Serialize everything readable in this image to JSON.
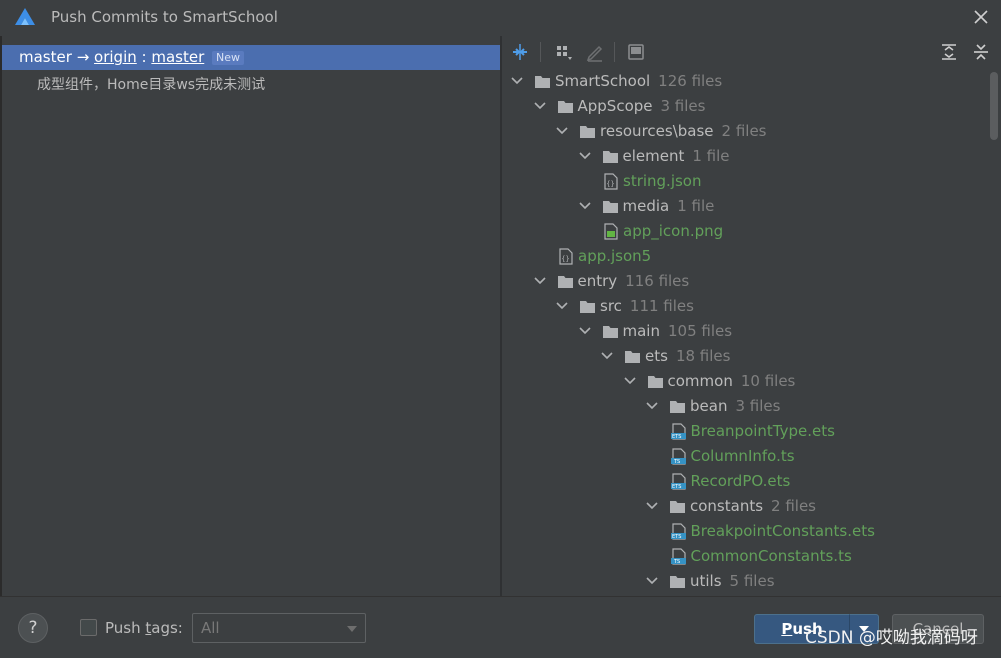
{
  "window": {
    "title": "Push Commits to SmartSchool"
  },
  "branch": {
    "local": "master",
    "arrow": "→",
    "remote": "origin",
    "sep": " : ",
    "target": "master",
    "badge": "New"
  },
  "commit": {
    "message": "成型组件，Home目录ws完成未测试"
  },
  "tree": [
    {
      "name": "SmartSchool",
      "count": "126 files",
      "type": "folder",
      "depth": 0,
      "expanded": true
    },
    {
      "name": "AppScope",
      "count": "3 files",
      "type": "folder",
      "depth": 1,
      "expanded": true
    },
    {
      "name": "resources\\base",
      "count": "2 files",
      "type": "folder",
      "depth": 2,
      "expanded": true
    },
    {
      "name": "element",
      "count": "1 file",
      "type": "folder",
      "depth": 3,
      "expanded": true
    },
    {
      "name": "string.json",
      "count": "",
      "type": "json",
      "depth": 4
    },
    {
      "name": "media",
      "count": "1 file",
      "type": "folder",
      "depth": 3,
      "expanded": true
    },
    {
      "name": "app_icon.png",
      "count": "",
      "type": "png",
      "depth": 4
    },
    {
      "name": "app.json5",
      "count": "",
      "type": "json",
      "depth": 2
    },
    {
      "name": "entry",
      "count": "116 files",
      "type": "folder",
      "depth": 1,
      "expanded": true
    },
    {
      "name": "src",
      "count": "111 files",
      "type": "folder",
      "depth": 2,
      "expanded": true
    },
    {
      "name": "main",
      "count": "105 files",
      "type": "folder",
      "depth": 3,
      "expanded": true
    },
    {
      "name": "ets",
      "count": "18 files",
      "type": "folder",
      "depth": 4,
      "expanded": true
    },
    {
      "name": "common",
      "count": "10 files",
      "type": "folder",
      "depth": 5,
      "expanded": true
    },
    {
      "name": "bean",
      "count": "3 files",
      "type": "folder",
      "depth": 6,
      "expanded": true
    },
    {
      "name": "BreanpointType.ets",
      "count": "",
      "type": "ets",
      "depth": 7
    },
    {
      "name": "ColumnInfo.ts",
      "count": "",
      "type": "ts",
      "depth": 7
    },
    {
      "name": "RecordPO.ets",
      "count": "",
      "type": "ets",
      "depth": 7
    },
    {
      "name": "constants",
      "count": "2 files",
      "type": "folder",
      "depth": 6,
      "expanded": true
    },
    {
      "name": "BreakpointConstants.ets",
      "count": "",
      "type": "ets",
      "depth": 7
    },
    {
      "name": "CommonConstants.ts",
      "count": "",
      "type": "ts",
      "depth": 7
    },
    {
      "name": "utils",
      "count": "5 files",
      "type": "folder",
      "depth": 6,
      "expanded": true
    }
  ],
  "footer": {
    "help": "?",
    "push_tags_label": "Push tags:",
    "tags_value": "All",
    "push_label": "Push",
    "cancel_label": "Cancel",
    "watermark": "CSDN @哎呦我滴码呀"
  },
  "colors": {
    "background": "#3c3f41",
    "selection": "#4b6eaf",
    "file_green": "#62a05a",
    "count_gray": "#808080",
    "primary_button": "#365880"
  },
  "icons": {
    "app_logo": "deveco-logo-icon",
    "close": "close-icon",
    "toolbar": [
      "expand-diff-icon",
      "group-by-icon",
      "edit-icon",
      "show-diff-icon",
      "expand-all-icon",
      "collapse-all-icon"
    ]
  }
}
